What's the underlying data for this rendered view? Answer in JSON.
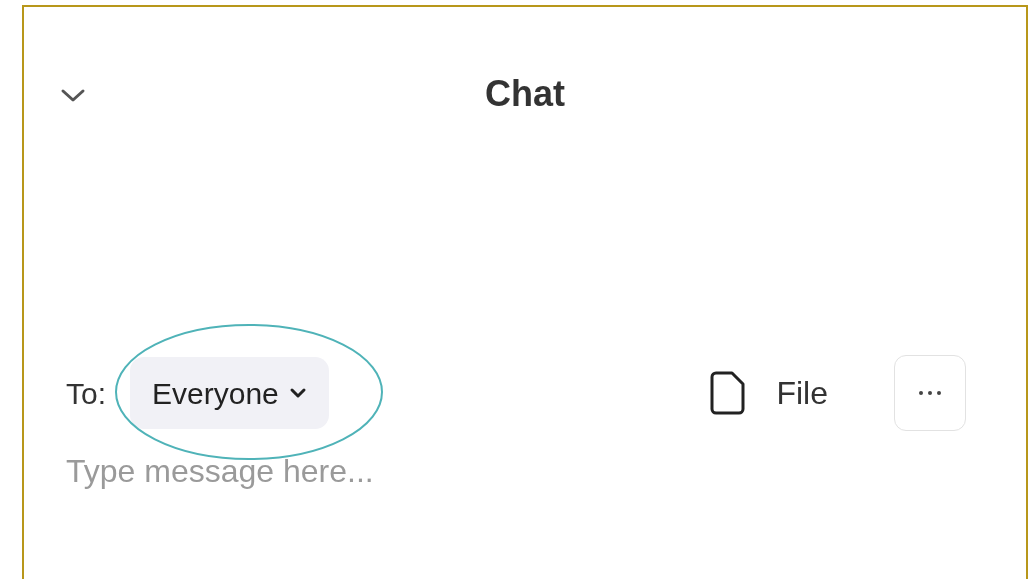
{
  "panel": {
    "title": "Chat"
  },
  "composer": {
    "to_label": "To:",
    "recipient": {
      "label": "Everyone",
      "highlighted": true
    },
    "file_button": {
      "label": "File"
    },
    "message": {
      "placeholder": "Type message here..."
    }
  }
}
